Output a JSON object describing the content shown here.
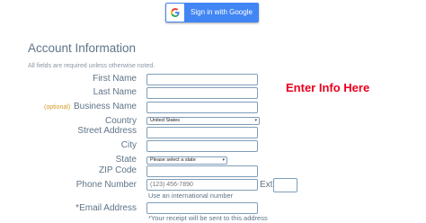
{
  "google_button": {
    "label": "Sign in with Google",
    "icon": "google-g-icon"
  },
  "form": {
    "title": "Account Information",
    "subtitle": "All fields are required unless otherwise noted.",
    "labels": {
      "first_name": "First Name",
      "last_name": "Last Name",
      "business_optional": "(optional)",
      "business_name": "Business Name",
      "country": "Country",
      "street": "Street Address",
      "city": "City",
      "state": "State",
      "zip": "ZIP Code",
      "phone": "Phone Number",
      "ext": "Ext",
      "email_required": "*",
      "email": "Email Address"
    },
    "values": {
      "first_name": "",
      "last_name": "",
      "business_name": "",
      "street": "",
      "city": "",
      "zip": "",
      "email": ""
    },
    "country_selected": "United States",
    "state_selected": "Please select a state",
    "phone_placeholder": "(123) 456-7890",
    "phone_hint": "Use an international number",
    "email_hint": "*Your receipt will be sent to this address"
  },
  "annotation": {
    "text": "Enter Info Here",
    "color": "#e8001c"
  },
  "colors": {
    "google_blue": "#4285f4",
    "label": "#5f7487",
    "optional": "#d49a2a",
    "border": "#7f9db9"
  }
}
